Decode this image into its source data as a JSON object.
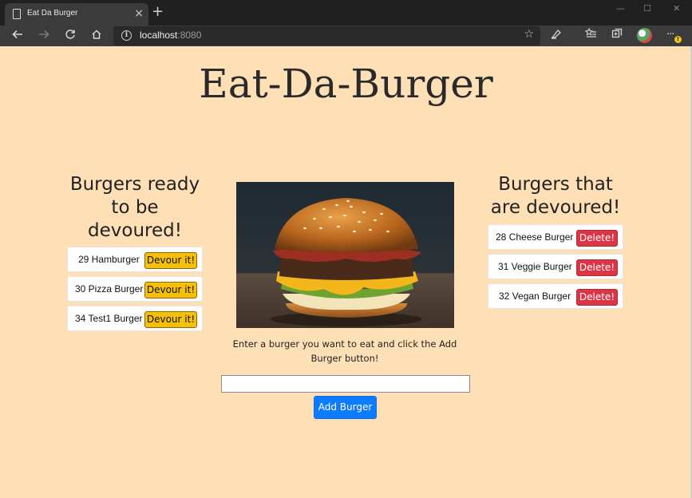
{
  "browser": {
    "tab_title": "Eat Da Burger",
    "tab_close": "×",
    "new_tab": "+",
    "address_host": "localhost",
    "address_port": ":8080",
    "window_controls": {
      "minimize": "—",
      "maximize": "☐",
      "close": "✕"
    }
  },
  "page": {
    "title": "Eat-Da-Burger",
    "ready": {
      "heading": "Burgers ready to be devoured!",
      "items": [
        {
          "label": "29 Hamburger",
          "button": "Devour it!"
        },
        {
          "label": "30 Pizza Burger",
          "button": "Devour it!"
        },
        {
          "label": "34 Test1 Burger",
          "button": "Devour it!"
        }
      ]
    },
    "devoured": {
      "heading": "Burgers that are devoured!",
      "items": [
        {
          "label": "28 Cheese Burger",
          "button": "Delete!"
        },
        {
          "label": "31 Veggie Burger",
          "button": "Delete!"
        },
        {
          "label": "32 Vegan Burger",
          "button": "Delete!"
        }
      ]
    },
    "caption": "Enter a burger you want to eat and click the Add Burger button!",
    "input": {
      "value": "",
      "placeholder": ""
    },
    "add_button": "Add Burger"
  },
  "colors": {
    "page_bg": "#ffdfb6",
    "devour_button": "#f5bf0a",
    "delete_button": "#dc3545",
    "add_button": "#0d7bff"
  }
}
